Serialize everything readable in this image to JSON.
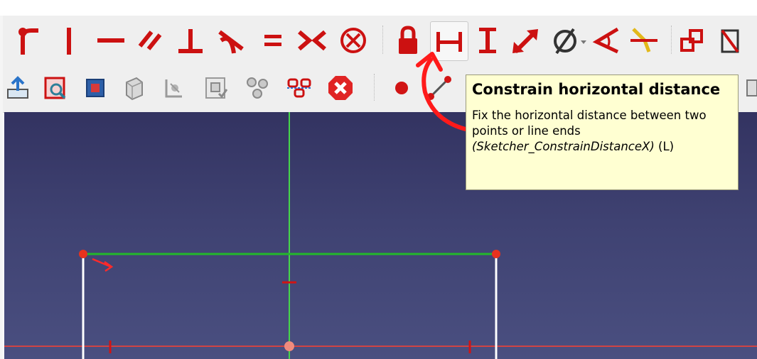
{
  "toolbar_constraints": {
    "items": [
      {
        "name": "constrain-fillet-icon"
      },
      {
        "name": "constrain-vertical-icon"
      },
      {
        "name": "constrain-horizontal-icon"
      },
      {
        "name": "constrain-parallel-icon"
      },
      {
        "name": "constrain-perpendicular-icon"
      },
      {
        "name": "constrain-tangent-icon"
      },
      {
        "name": "constrain-equal-icon"
      },
      {
        "name": "constrain-symmetric-icon"
      },
      {
        "name": "constrain-block-icon"
      },
      {
        "name": "constrain-lock-icon"
      },
      {
        "name": "constrain-horizontal-distance-icon",
        "active": true
      },
      {
        "name": "constrain-vertical-distance-icon"
      },
      {
        "name": "constrain-distance-icon"
      },
      {
        "name": "constrain-diameter-icon",
        "has_dropdown": true
      },
      {
        "name": "constrain-angle-icon"
      },
      {
        "name": "constrain-snell-law-icon"
      },
      {
        "name": "toggle-driving-icon"
      }
    ]
  },
  "toolbar_sketch": {
    "items": [
      {
        "name": "leave-sketch-icon"
      },
      {
        "name": "view-sketch-icon"
      },
      {
        "name": "view-section-icon"
      },
      {
        "name": "map-sketch-icon"
      },
      {
        "name": "reorient-sketch-icon"
      },
      {
        "name": "validate-sketch-icon"
      },
      {
        "name": "merge-sketches-icon"
      },
      {
        "name": "mirror-sketch-icon"
      },
      {
        "name": "stop-operation-icon"
      },
      {
        "name": "create-point-icon"
      },
      {
        "name": "create-line-icon"
      }
    ]
  },
  "tooltip": {
    "title": "Constrain horizontal distance",
    "description": "Fix the horizontal distance between two points or line ends",
    "command": "(Sketcher_ConstrainDistanceX)",
    "shortcut": " (L)"
  },
  "colors": {
    "constraint_red": "#cc1111",
    "toolbar_bg": "#efefef",
    "tooltip_bg": "#ffffd2",
    "viewport_top": "#333361",
    "viewport_bottom": "#4a4f80",
    "line_green": "#23b82b",
    "axis_green": "#46d64a",
    "axis_red": "#d04444",
    "vertex_red": "#e8321e",
    "annotation_red": "#ff1a1a"
  }
}
